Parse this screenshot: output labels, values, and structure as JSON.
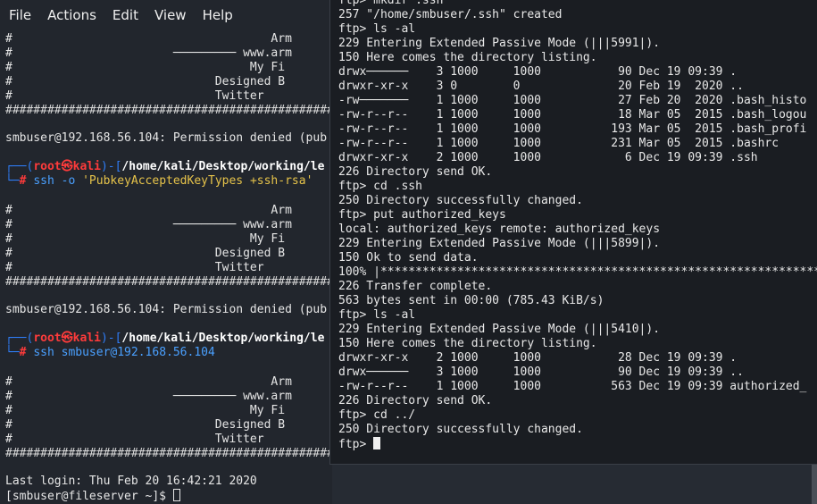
{
  "menu": {
    "file": "File",
    "actions": "Actions",
    "edit": "Edit",
    "view": "View",
    "help": "Help"
  },
  "left_terminal": {
    "banner1": {
      "l1": "#                                     Arm",
      "l2": "#                       ───────── www.arm",
      "l3": "#                                  My Fi",
      "l4": "#                             Designed B",
      "l5": "#                             Twitter"
    },
    "hash_line": "#####################################################",
    "denied1": "smbuser@192.168.56.104: Permission denied (pub",
    "prompt1": {
      "open": "┌──(",
      "user": "root㉿kali",
      "close": ")-[",
      "path": "/home/kali/Desktop/working/le",
      "lead": "└─",
      "hash": "# ",
      "cmd_a": "ssh -o ",
      "cmd_b": "'PubkeyAcceptedKeyTypes +ssh-rsa'"
    },
    "banner2": {
      "l1": "#                                     Arm",
      "l2": "#                       ───────── www.arm",
      "l3": "#                                  My Fi",
      "l4": "#                             Designed B",
      "l5": "#                             Twitter"
    },
    "denied2": "smbuser@192.168.56.104: Permission denied (pub",
    "prompt2": {
      "open": "┌──(",
      "user": "root㉿kali",
      "close": ")-[",
      "path": "/home/kali/Desktop/working/le",
      "lead": "└─",
      "hash": "# ",
      "cmd": "ssh smbuser@192.168.56.104"
    },
    "banner3": {
      "l1": "#                                     Arm",
      "l2": "#                       ───────── www.arm",
      "l3": "#                                  My Fi",
      "l4": "#                             Designed B",
      "l5": "#                             Twitter"
    },
    "last_login": "Last login: Thu Feb 20 16:42:21 2020",
    "shell_prompt": "[smbuser@fileserver ~]$ "
  },
  "ftp_terminal": {
    "lines": [
      "ftp> mkdir .ssh",
      "257 \"/home/smbuser/.ssh\" created",
      "ftp> ls -al",
      "229 Entering Extended Passive Mode (|||5991|).",
      "150 Here comes the directory listing.",
      "drwx──────    3 1000     1000           90 Dec 19 09:39 .",
      "drwxr-xr-x    3 0        0              20 Feb 19  2020 ..",
      "-rw───────    1 1000     1000           27 Feb 20  2020 .bash_histo",
      "-rw-r--r--    1 1000     1000           18 Mar 05  2015 .bash_logou",
      "-rw-r--r--    1 1000     1000          193 Mar 05  2015 .bash_profi",
      "-rw-r--r--    1 1000     1000          231 Mar 05  2015 .bashrc",
      "drwxr-xr-x    2 1000     1000            6 Dec 19 09:39 .ssh",
      "226 Directory send OK.",
      "ftp> cd .ssh",
      "250 Directory successfully changed.",
      "ftp> put authorized_keys",
      "local: authorized_keys remote: authorized_keys",
      "229 Entering Extended Passive Mode (|||5899|).",
      "150 Ok to send data.",
      "100% |*****************************************************************",
      "226 Transfer complete.",
      "563 bytes sent in 00:00 (785.43 KiB/s)",
      "ftp> ls -al",
      "229 Entering Extended Passive Mode (|||5410|).",
      "150 Here comes the directory listing.",
      "drwxr-xr-x    2 1000     1000           28 Dec 19 09:39 .",
      "drwx──────    3 1000     1000           90 Dec 19 09:39 ..",
      "-rw-r--r--    1 1000     1000          563 Dec 19 09:39 authorized_",
      "226 Directory send OK.",
      "ftp> cd ../",
      "250 Directory successfully changed."
    ],
    "prompt": "ftp> "
  },
  "colors": {
    "prompt_red": "#ff3b3b",
    "prompt_blue": "#2f7df6",
    "terminal_bg": "#1a1d22"
  }
}
